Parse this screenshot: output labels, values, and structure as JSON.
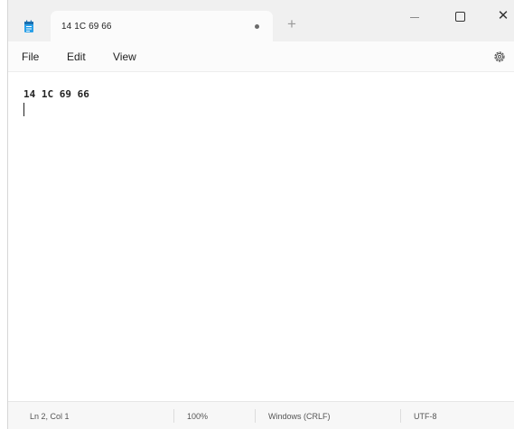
{
  "tab": {
    "title": "14 1C 69 66",
    "new_tab_label": "+"
  },
  "window_controls": {
    "close_label": "✕"
  },
  "menu": {
    "file": "File",
    "edit": "Edit",
    "view": "View"
  },
  "editor": {
    "content": "14 1C 69 66"
  },
  "status": {
    "position": "Ln 2, Col 1",
    "zoom": "100%",
    "line_ending": "Windows (CRLF)",
    "encoding": "UTF-8"
  },
  "colors": {
    "accent": "#1a8fd6",
    "titlebar_bg": "#f0f0f0",
    "tab_bg": "#fbfbfb"
  },
  "icons": [
    "notepad-app-icon",
    "unsaved-dot-icon",
    "plus-icon",
    "minimize-icon",
    "maximize-icon",
    "close-icon",
    "gear-icon"
  ]
}
